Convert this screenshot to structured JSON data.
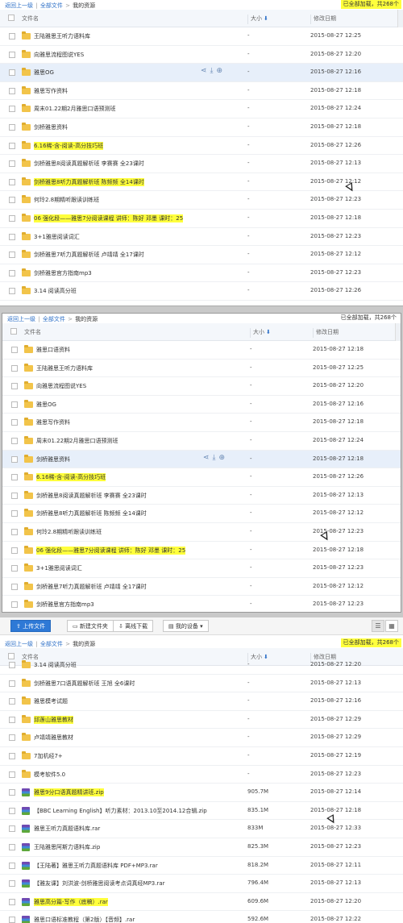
{
  "breadcrumb": {
    "back": "返回上一级",
    "all_files": "全部文件",
    "sep": ">",
    "current": "我的资源",
    "bar": "|"
  },
  "loaded_status": "已全部加载，共268个",
  "header": {
    "name": "文件名",
    "size": "大小",
    "date": "修改日期",
    "sort_arrow": "⬇"
  },
  "toolbar": {
    "upload": "上传文件",
    "new_folder": "新建文件夹",
    "offline": "离线下载",
    "device": "我的设备"
  },
  "panel1_rows": [
    {
      "name": "王陆雅思王听力语料库",
      "size": "-",
      "date": "2015-08-27 12:25",
      "type": "folder"
    },
    {
      "name": "向雅思流程图说YES",
      "size": "-",
      "date": "2015-08-27 12:20",
      "type": "folder"
    },
    {
      "name": "雅思OG",
      "size": "-",
      "date": "2015-08-27 12:16",
      "type": "folder",
      "hover": true
    },
    {
      "name": "雅思写作资料",
      "size": "-",
      "date": "2015-08-27 12:18",
      "type": "folder"
    },
    {
      "name": "周末01.22期2月雅思口语预测班",
      "size": "-",
      "date": "2015-08-27 12:24",
      "type": "folder"
    },
    {
      "name": "剑桥雅思资料",
      "size": "-",
      "date": "2015-08-27 12:18",
      "type": "folder"
    },
    {
      "name": "6.16稀-含-阅读-高分技巧班",
      "size": "-",
      "date": "2015-08-27 12:26",
      "type": "folder",
      "hl": true
    },
    {
      "name": "剑桥雅思8阅读真题解析班 李赛赛 全23课时",
      "size": "-",
      "date": "2015-08-27 12:13",
      "type": "folder"
    },
    {
      "name": "剑桥雅思8听力真题解析班 陈频频 全14课时",
      "size": "-",
      "date": "2015-08-27 12:12",
      "type": "folder",
      "hl": true
    },
    {
      "name": "何玲2.8期精听跟读训练班",
      "size": "-",
      "date": "2015-08-27 12:23",
      "type": "folder"
    },
    {
      "name": "06 强化段——雅思7分阅读课程 讲师：陈好 邓墨 课时：25",
      "size": "-",
      "date": "2015-08-27 12:18",
      "type": "folder",
      "hl": true
    },
    {
      "name": "3+1雅思阅读词汇",
      "size": "-",
      "date": "2015-08-27 12:23",
      "type": "folder"
    },
    {
      "name": "剑桥雅思7听力真题解析班 卢靖靖 全17课时",
      "size": "-",
      "date": "2015-08-27 12:12",
      "type": "folder"
    },
    {
      "name": "剑桥雅思官方指南mp3",
      "size": "-",
      "date": "2015-08-27 12:23",
      "type": "folder"
    },
    {
      "name": "3.14 阅读高分班",
      "size": "-",
      "date": "2015-08-27 12:26",
      "type": "folder"
    }
  ],
  "panel2_rows": [
    {
      "name": "雅思口语资料",
      "size": "-",
      "date": "2015-08-27 12:18",
      "type": "folder"
    },
    {
      "name": "王陆雅思王听力语料库",
      "size": "-",
      "date": "2015-08-27 12:25",
      "type": "folder"
    },
    {
      "name": "向雅思流程图说YES",
      "size": "-",
      "date": "2015-08-27 12:20",
      "type": "folder"
    },
    {
      "name": "雅思OG",
      "size": "-",
      "date": "2015-08-27 12:16",
      "type": "folder"
    },
    {
      "name": "雅思写作资料",
      "size": "-",
      "date": "2015-08-27 12:18",
      "type": "folder"
    },
    {
      "name": "周末01.22期2月雅思口语预测班",
      "size": "-",
      "date": "2015-08-27 12:24",
      "type": "folder"
    },
    {
      "name": "剑桥雅思资料",
      "size": "-",
      "date": "2015-08-27 12:18",
      "type": "folder",
      "hover": true
    },
    {
      "name": "6.16稀-含-阅读-高分技巧班",
      "size": "-",
      "date": "2015-08-27 12:26",
      "type": "folder",
      "hl": true
    },
    {
      "name": "剑桥雅思8阅读真题解析班 李赛赛 全23课时",
      "size": "-",
      "date": "2015-08-27 12:13",
      "type": "folder"
    },
    {
      "name": "剑桥雅思8听力真题解析班 陈频频 全14课时",
      "size": "-",
      "date": "2015-08-27 12:12",
      "type": "folder"
    },
    {
      "name": "何玲2.8期精听跟读训练班",
      "size": "-",
      "date": "2015-08-27 12:23",
      "type": "folder"
    },
    {
      "name": "06 强化段——雅思7分阅读课程 讲师：陈好 邓墨 课时：25",
      "size": "-",
      "date": "2015-08-27 12:18",
      "type": "folder",
      "hl": true
    },
    {
      "name": "3+1雅思阅读词汇",
      "size": "-",
      "date": "2015-08-27 12:23",
      "type": "folder"
    },
    {
      "name": "剑桥雅思7听力真题解析班 卢靖靖 全17课时",
      "size": "-",
      "date": "2015-08-27 12:12",
      "type": "folder"
    },
    {
      "name": "剑桥雅思官方指南mp3",
      "size": "-",
      "date": "2015-08-27 12:23",
      "type": "folder"
    }
  ],
  "panel3_rows": [
    {
      "name": "3.14 阅读高分班",
      "size": "-",
      "date": "2015-08-27 12:20",
      "type": "folder",
      "partial": true
    },
    {
      "name": "剑桥雅思7口语真题解析班 王旭 全6课时",
      "size": "-",
      "date": "2015-08-27 12:13",
      "type": "folder"
    },
    {
      "name": "雅思模考试题",
      "size": "-",
      "date": "2015-08-27 12:16",
      "type": "folder"
    },
    {
      "name": "邱莲山雅思教材",
      "size": "-",
      "date": "2015-08-27 12:29",
      "type": "folder",
      "hl": true
    },
    {
      "name": "卢靖靖雅思教材",
      "size": "-",
      "date": "2015-08-27 12:29",
      "type": "folder"
    },
    {
      "name": "7加机经7+",
      "size": "-",
      "date": "2015-08-27 12:19",
      "type": "folder"
    },
    {
      "name": "模考软件5.0",
      "size": "-",
      "date": "2015-08-27 12:23",
      "type": "folder"
    },
    {
      "name": "雅思9分口语真题精讲班.zip",
      "size": "905.7M",
      "date": "2015-08-27 12:14",
      "type": "rar",
      "hl": true
    },
    {
      "name": "【BBC Learning English】听力素材：2013.10至2014.12合辑.zip",
      "size": "835.1M",
      "date": "2015-08-27 12:18",
      "type": "rar"
    },
    {
      "name": "雅思王听力真题语料库.rar",
      "size": "833M",
      "date": "2015-08-27 12:33",
      "type": "rar"
    },
    {
      "name": "王陆雅思阿斯力语料库.zip",
      "size": "825.3M",
      "date": "2015-08-27 12:23",
      "type": "rar"
    },
    {
      "name": "【王陆著】雅思王听力真题语料库 PDF+MP3.rar",
      "size": "818.2M",
      "date": "2015-08-27 12:11",
      "type": "rar"
    },
    {
      "name": "【雅友课】刘洪波-剑桥雅思阅读考点词真经MP3.rar",
      "size": "796.4M",
      "date": "2015-08-27 12:13",
      "type": "rar"
    },
    {
      "name": "雅思高分篇-写作（底稿）.rar",
      "size": "609.6M",
      "date": "2015-08-27 12:20",
      "type": "rar",
      "hl": true
    },
    {
      "name": "雅思口语标准教程（第2版）【音频】.rar",
      "size": "592.6M",
      "date": "2015-08-27 12:22",
      "type": "rar",
      "partial": true
    }
  ]
}
